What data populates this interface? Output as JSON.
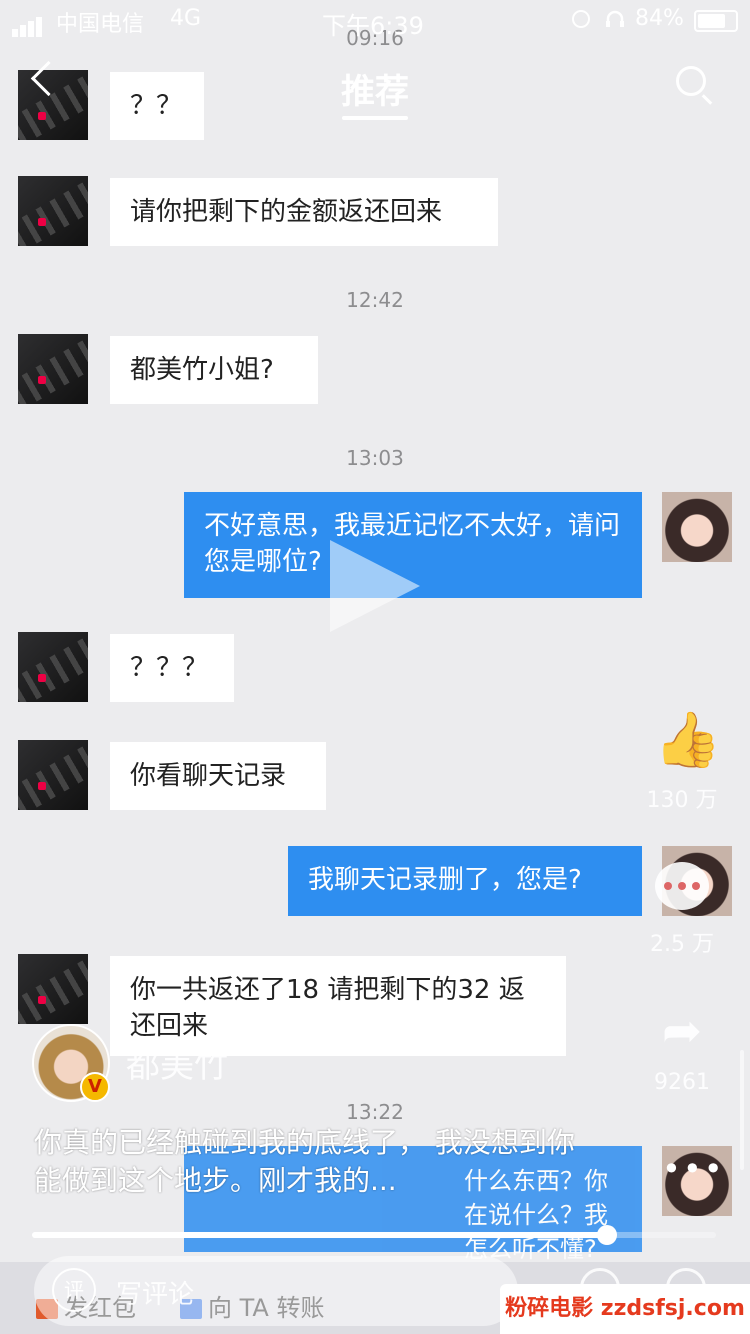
{
  "status_bar": {
    "carrier": "中国电信",
    "network": "4G",
    "time": "下午6:39",
    "battery_pct": "84%",
    "battery_level": 0.84
  },
  "topbar": {
    "title": "推荐"
  },
  "timestamps": [
    "09:16",
    "12:42",
    "13:03",
    "13:22"
  ],
  "messages": [
    {
      "side": "left",
      "text": "？？"
    },
    {
      "side": "left",
      "text": "请你把剩下的金额返还回来"
    },
    {
      "side": "left",
      "text": "都美竹小姐?"
    },
    {
      "side": "right",
      "text": "不好意思，我最近记忆不太好，请问您是哪位?"
    },
    {
      "side": "left",
      "text": "？？？"
    },
    {
      "side": "left",
      "text": "你看聊天记录"
    },
    {
      "side": "right",
      "text": "我聊天记录删了，您是?"
    },
    {
      "side": "left",
      "text": "你一共返还了18  请把剩下的32 返还回来"
    },
    {
      "side": "right",
      "text": "什么东西？你在说什么？我怎么听不懂?"
    }
  ],
  "actions": {
    "likes": "130 万",
    "comments": "2.5 万",
    "shares": "9261"
  },
  "author": {
    "name": "都美竹",
    "verified_badge": "V"
  },
  "caption": "你真的已经触碰到我的底线了， 我没想到你能做到这个地步。刚才我的...",
  "progress": {
    "fraction": 0.84
  },
  "bottom_bar": {
    "comment_badge": "评",
    "comment_placeholder": "写评论",
    "red_packet": "发红包",
    "transfer": "向 TA 转账"
  },
  "watermark": "粉碎电影 zzdsfsj.com",
  "colors": {
    "bubble_right": "#2e8ef0",
    "bubble_left": "#ffffff",
    "watermark": "#e53a1e"
  }
}
